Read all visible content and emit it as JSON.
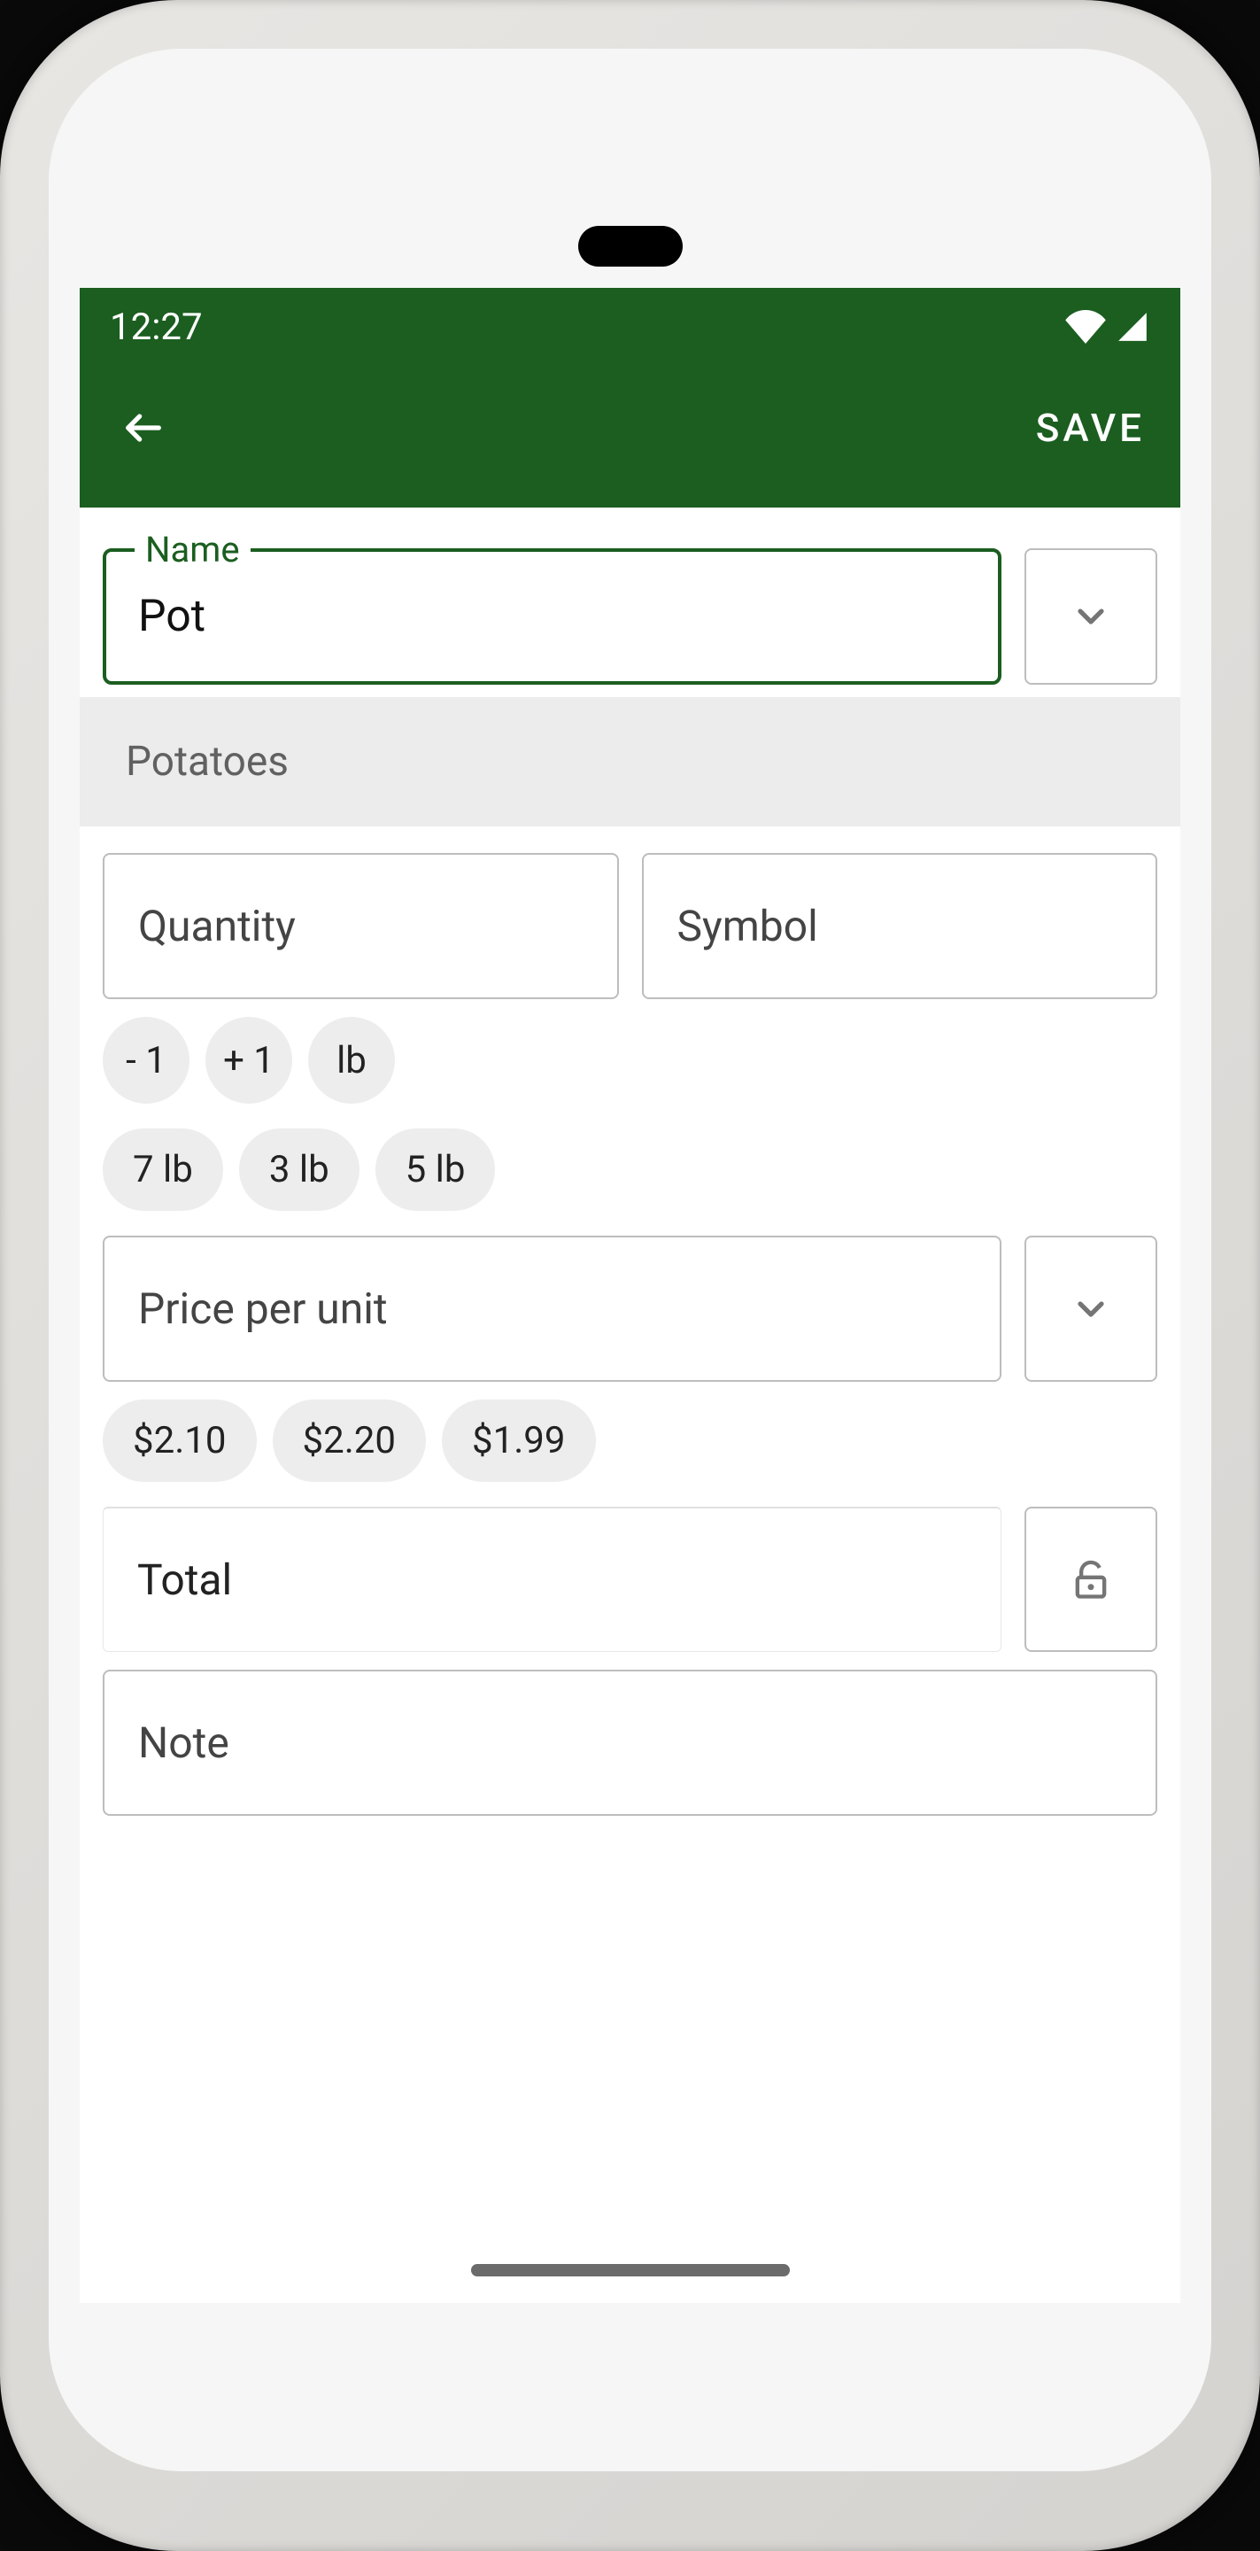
{
  "status": {
    "time": "12:27"
  },
  "appbar": {
    "save_label": "SAVE"
  },
  "name": {
    "label": "Name",
    "value": "Pot",
    "suggestion": "Potatoes"
  },
  "quantity": {
    "placeholder": "Quantity"
  },
  "symbol": {
    "placeholder": "Symbol"
  },
  "qty_chips_row1": [
    "- 1",
    "+ 1",
    "lb"
  ],
  "qty_chips_row2": [
    "7 lb",
    "3 lb",
    "5 lb"
  ],
  "price": {
    "placeholder": "Price per unit"
  },
  "price_chips": [
    "$2.10",
    "$2.20",
    "$1.99"
  ],
  "total": {
    "placeholder": "Total"
  },
  "note": {
    "placeholder": "Note"
  },
  "colors": {
    "primary": "#1b5e20"
  }
}
